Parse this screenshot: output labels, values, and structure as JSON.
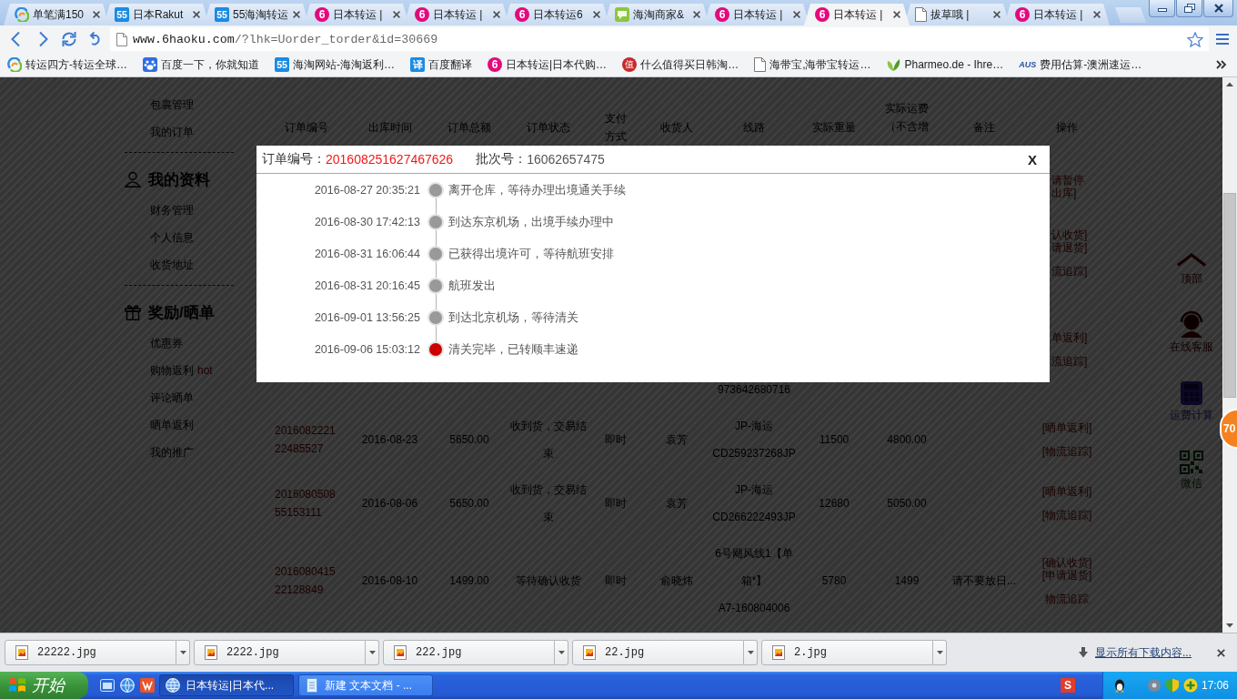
{
  "browser": {
    "tabs": [
      {
        "kind": "swirl",
        "title": "单笔满150",
        "selected": false
      },
      {
        "kind": "square",
        "icon_text": "55",
        "title": "日本Rakut",
        "selected": false
      },
      {
        "kind": "square",
        "icon_text": "55",
        "title": "55海淘转运",
        "selected": false
      },
      {
        "kind": "circle",
        "icon_text": "6",
        "title": "日本转运 |",
        "selected": false
      },
      {
        "kind": "circle",
        "icon_text": "6",
        "title": "日本转运 |",
        "selected": false
      },
      {
        "kind": "circle",
        "icon_text": "6",
        "title": "日本转运6",
        "selected": false
      },
      {
        "kind": "chat",
        "title": "海淘商家&",
        "selected": false
      },
      {
        "kind": "circle",
        "icon_text": "6",
        "title": "日本转运 |",
        "selected": false
      },
      {
        "kind": "circle",
        "icon_text": "6",
        "title": "日本转运 |",
        "selected": true
      },
      {
        "kind": "doc",
        "title": "拔草哦 |",
        "selected": false
      },
      {
        "kind": "circle",
        "icon_text": "6",
        "title": "日本转运 |",
        "selected": false
      }
    ],
    "address": {
      "host": "www.6haoku.com",
      "path": "/?lhk=Uorder_torder&id=30669"
    },
    "bookmarks": [
      {
        "kind": "swirl",
        "title": "转运四方-转运全球…"
      },
      {
        "kind": "paw",
        "title": "百度一下，你就知道"
      },
      {
        "kind": "square",
        "icon_text": "55",
        "title": "海淘网站-海淘返利…"
      },
      {
        "kind": "square",
        "icon_text": "译",
        "title": "百度翻译"
      },
      {
        "kind": "circle",
        "icon_text": "6",
        "title": "日本转运|日本代购…"
      },
      {
        "kind": "seal",
        "icon_text": "值",
        "title": "什么值得买日韩淘…"
      },
      {
        "kind": "doc",
        "title": "海带宝,海带宝转运…"
      },
      {
        "kind": "leaf",
        "title": "Pharmeo.de - Ihre…"
      },
      {
        "kind": "wordmark",
        "icon_text": "AUS",
        "title": "费用估算-澳洲速运…"
      }
    ]
  },
  "page": {
    "sidebar": [
      {
        "items": [
          {
            "label": "包裹管理"
          },
          {
            "label": "我的订单"
          }
        ]
      },
      {
        "kind": "person",
        "heading": "我的资料",
        "items": [
          {
            "label": "财务管理"
          },
          {
            "label": "个人信息"
          },
          {
            "label": "收货地址"
          }
        ]
      },
      {
        "kind": "gift",
        "heading": "奖励/晒单",
        "items": [
          {
            "label": "优惠券"
          },
          {
            "label": "购物返利",
            "tag": "hot"
          },
          {
            "label": "评论晒单"
          },
          {
            "label": "晒单返利"
          },
          {
            "label": "我的推广"
          }
        ]
      }
    ],
    "orders_table": {
      "columns": [
        "订单编号",
        "出库时间",
        "订单总额",
        "订单状态",
        "支付方式",
        "收货人",
        "线路",
        "实际重量",
        "实际运费（不含增",
        "备注",
        "操作"
      ],
      "covered_rows": [
        {
          "ops": [
            [
              "请暂停",
              "出库]"
            ]
          ]
        },
        {
          "ops": [
            [
              "认收货]",
              "请退货]"
            ],
            [
              "流追踪]"
            ]
          ]
        },
        {
          "route": "973642680716",
          "ops": [
            [
              "单返利]"
            ],
            [
              "流追踪]"
            ]
          ]
        }
      ],
      "rows": [
        {
          "order_no": "201608222122485527",
          "shipped": "2016-08-23",
          "total": "5650.00",
          "status": "收到货，交易结束",
          "payment": "即时",
          "consignee": "袁芳",
          "route": "JP-海运",
          "tracking": "CD259237268JP",
          "weight": "11500",
          "fee": "4800.00",
          "ops": [
            [
              "[晒单返利]"
            ],
            [
              "[物流追踪]"
            ]
          ]
        },
        {
          "order_no": "201608050855153111",
          "shipped": "2016-08-06",
          "total": "5650.00",
          "status": "收到货，交易结束",
          "payment": "即时",
          "consignee": "袁芳",
          "route": "JP-海运",
          "tracking": "CD266222493JP",
          "weight": "12680",
          "fee": "5050.00",
          "ops": [
            [
              "[晒单返利]"
            ],
            [
              "[物流追踪]"
            ]
          ]
        },
        {
          "order_no": "201608041522128849",
          "shipped": "2016-08-10",
          "total": "1499.00",
          "status": "等待确认收货",
          "payment": "即时",
          "consignee": "俞晓炜",
          "route": "6号飓风线1【单箱*】",
          "tracking": "A7-160804006",
          "weight": "5780",
          "fee": "1499",
          "note": "请不要放日...",
          "ops": [
            [
              "[确认收货]",
              "[申请退货]"
            ],
            [
              "物流追踪"
            ]
          ]
        }
      ]
    },
    "float_bar": [
      {
        "kind": "top",
        "label": "顶部"
      },
      {
        "kind": "service",
        "label": "在线客服"
      },
      {
        "kind": "calculator",
        "label": "运费计算"
      },
      {
        "kind": "qr",
        "label": "微信"
      }
    ],
    "badge": "70"
  },
  "modal": {
    "order_label": "订单编号：",
    "order_no": "201608251627467626",
    "batch_label": "批次号：",
    "batch_no": "16062657475",
    "close": "X",
    "events": [
      {
        "time": "2016-08-27 20:35:21",
        "text": "离开仓库，等待办理出境通关手续",
        "current": false
      },
      {
        "time": "2016-08-30 17:42:13",
        "text": "到达东京机场，出境手续办理中",
        "current": false
      },
      {
        "time": "2016-08-31 16:06:44",
        "text": "已获得出境许可，等待航班安排",
        "current": false
      },
      {
        "time": "2016-08-31 20:16:45",
        "text": "航班发出",
        "current": false
      },
      {
        "time": "2016-09-01 13:56:25",
        "text": "到达北京机场，等待清关",
        "current": false
      },
      {
        "time": "2016-09-06 15:03:12",
        "text": "清关完毕，已转顺丰速递",
        "current": true
      }
    ]
  },
  "downloads": {
    "files": [
      "22222.jpg",
      "2222.jpg",
      "222.jpg",
      "22.jpg",
      "2.jpg"
    ],
    "show_all": "显示所有下载内容..."
  },
  "taskbar": {
    "start": "开始",
    "tasks": [
      {
        "kind": "browser",
        "label": "日本转运|日本代...",
        "selected": true
      },
      {
        "kind": "notepad",
        "label": "新建 文本文档 - ...",
        "selected": false
      }
    ],
    "ime": "S",
    "clock": "17:06"
  }
}
